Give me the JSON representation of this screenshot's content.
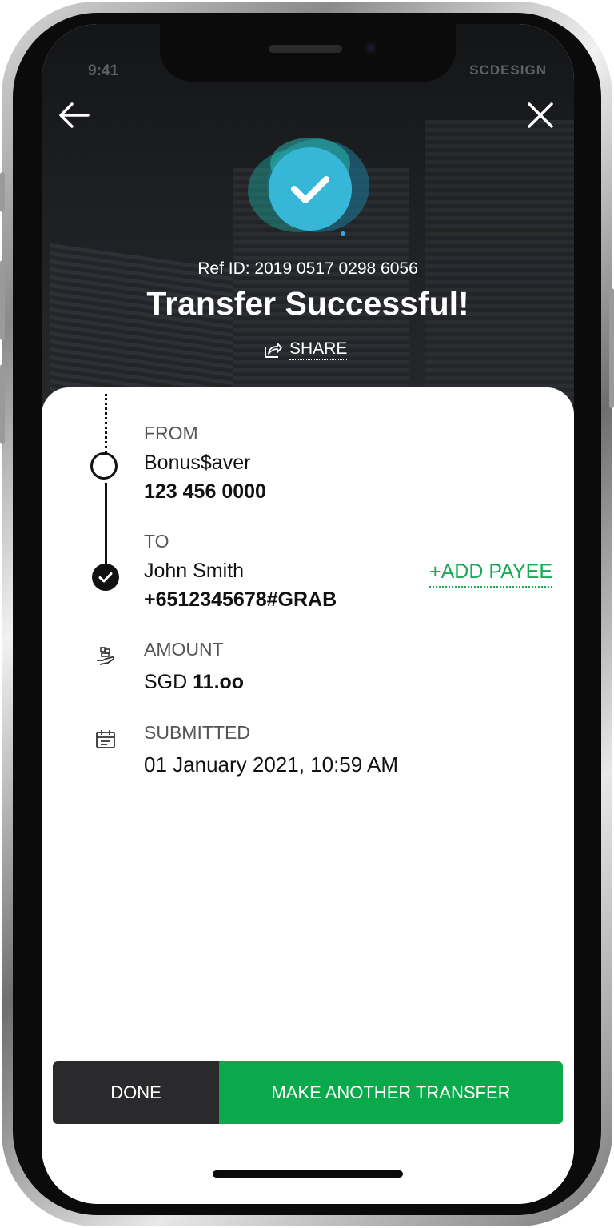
{
  "status_bar": {
    "time": "9:41",
    "brand": "SCDESIGN"
  },
  "header": {
    "ref_id": "Ref ID: 2019 0517 0298 6056",
    "title": "Transfer Successful!",
    "share_label": "SHARE"
  },
  "details": {
    "from": {
      "label": "FROM",
      "account_name": "Bonus$aver",
      "account_number": "123 456 0000"
    },
    "to": {
      "label": "TO",
      "payee_name": "John Smith",
      "payee_id": "+6512345678#GRAB",
      "add_payee_label": "+ADD PAYEE"
    },
    "amount": {
      "label": "AMOUNT",
      "currency": "SGD",
      "value": "11.oo"
    },
    "submitted": {
      "label": "SUBMITTED",
      "datetime": "01 January 2021, 10:59 AM"
    }
  },
  "actions": {
    "done_label": "DONE",
    "another_label": "MAKE ANOTHER TRANSFER"
  },
  "icons": {
    "back": "arrow-left-icon",
    "close": "close-icon",
    "success": "checkmark-badge-icon",
    "share": "share-icon",
    "amount": "money-hand-icon",
    "submitted": "calendar-icon"
  },
  "colors": {
    "accent_green": "#0aa94c",
    "dark_button": "#2a292b",
    "badge_blue": "#3da8e0",
    "badge_teal": "#2dd4c8"
  }
}
